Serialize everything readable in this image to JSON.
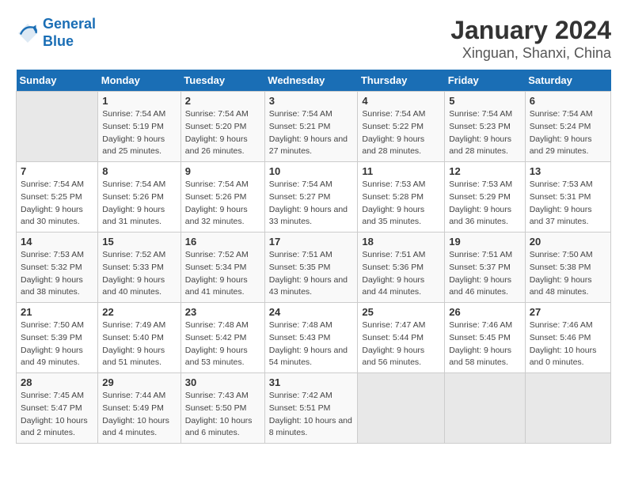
{
  "logo": {
    "line1": "General",
    "line2": "Blue"
  },
  "title": "January 2024",
  "subtitle": "Xinguan, Shanxi, China",
  "days_of_week": [
    "Sunday",
    "Monday",
    "Tuesday",
    "Wednesday",
    "Thursday",
    "Friday",
    "Saturday"
  ],
  "weeks": [
    [
      {
        "day": "",
        "sunrise": "",
        "sunset": "",
        "daylight": ""
      },
      {
        "day": "1",
        "sunrise": "Sunrise: 7:54 AM",
        "sunset": "Sunset: 5:19 PM",
        "daylight": "Daylight: 9 hours and 25 minutes."
      },
      {
        "day": "2",
        "sunrise": "Sunrise: 7:54 AM",
        "sunset": "Sunset: 5:20 PM",
        "daylight": "Daylight: 9 hours and 26 minutes."
      },
      {
        "day": "3",
        "sunrise": "Sunrise: 7:54 AM",
        "sunset": "Sunset: 5:21 PM",
        "daylight": "Daylight: 9 hours and 27 minutes."
      },
      {
        "day": "4",
        "sunrise": "Sunrise: 7:54 AM",
        "sunset": "Sunset: 5:22 PM",
        "daylight": "Daylight: 9 hours and 28 minutes."
      },
      {
        "day": "5",
        "sunrise": "Sunrise: 7:54 AM",
        "sunset": "Sunset: 5:23 PM",
        "daylight": "Daylight: 9 hours and 28 minutes."
      },
      {
        "day": "6",
        "sunrise": "Sunrise: 7:54 AM",
        "sunset": "Sunset: 5:24 PM",
        "daylight": "Daylight: 9 hours and 29 minutes."
      }
    ],
    [
      {
        "day": "7",
        "sunrise": "Sunrise: 7:54 AM",
        "sunset": "Sunset: 5:25 PM",
        "daylight": "Daylight: 9 hours and 30 minutes."
      },
      {
        "day": "8",
        "sunrise": "Sunrise: 7:54 AM",
        "sunset": "Sunset: 5:26 PM",
        "daylight": "Daylight: 9 hours and 31 minutes."
      },
      {
        "day": "9",
        "sunrise": "Sunrise: 7:54 AM",
        "sunset": "Sunset: 5:26 PM",
        "daylight": "Daylight: 9 hours and 32 minutes."
      },
      {
        "day": "10",
        "sunrise": "Sunrise: 7:54 AM",
        "sunset": "Sunset: 5:27 PM",
        "daylight": "Daylight: 9 hours and 33 minutes."
      },
      {
        "day": "11",
        "sunrise": "Sunrise: 7:53 AM",
        "sunset": "Sunset: 5:28 PM",
        "daylight": "Daylight: 9 hours and 35 minutes."
      },
      {
        "day": "12",
        "sunrise": "Sunrise: 7:53 AM",
        "sunset": "Sunset: 5:29 PM",
        "daylight": "Daylight: 9 hours and 36 minutes."
      },
      {
        "day": "13",
        "sunrise": "Sunrise: 7:53 AM",
        "sunset": "Sunset: 5:31 PM",
        "daylight": "Daylight: 9 hours and 37 minutes."
      }
    ],
    [
      {
        "day": "14",
        "sunrise": "Sunrise: 7:53 AM",
        "sunset": "Sunset: 5:32 PM",
        "daylight": "Daylight: 9 hours and 38 minutes."
      },
      {
        "day": "15",
        "sunrise": "Sunrise: 7:52 AM",
        "sunset": "Sunset: 5:33 PM",
        "daylight": "Daylight: 9 hours and 40 minutes."
      },
      {
        "day": "16",
        "sunrise": "Sunrise: 7:52 AM",
        "sunset": "Sunset: 5:34 PM",
        "daylight": "Daylight: 9 hours and 41 minutes."
      },
      {
        "day": "17",
        "sunrise": "Sunrise: 7:51 AM",
        "sunset": "Sunset: 5:35 PM",
        "daylight": "Daylight: 9 hours and 43 minutes."
      },
      {
        "day": "18",
        "sunrise": "Sunrise: 7:51 AM",
        "sunset": "Sunset: 5:36 PM",
        "daylight": "Daylight: 9 hours and 44 minutes."
      },
      {
        "day": "19",
        "sunrise": "Sunrise: 7:51 AM",
        "sunset": "Sunset: 5:37 PM",
        "daylight": "Daylight: 9 hours and 46 minutes."
      },
      {
        "day": "20",
        "sunrise": "Sunrise: 7:50 AM",
        "sunset": "Sunset: 5:38 PM",
        "daylight": "Daylight: 9 hours and 48 minutes."
      }
    ],
    [
      {
        "day": "21",
        "sunrise": "Sunrise: 7:50 AM",
        "sunset": "Sunset: 5:39 PM",
        "daylight": "Daylight: 9 hours and 49 minutes."
      },
      {
        "day": "22",
        "sunrise": "Sunrise: 7:49 AM",
        "sunset": "Sunset: 5:40 PM",
        "daylight": "Daylight: 9 hours and 51 minutes."
      },
      {
        "day": "23",
        "sunrise": "Sunrise: 7:48 AM",
        "sunset": "Sunset: 5:42 PM",
        "daylight": "Daylight: 9 hours and 53 minutes."
      },
      {
        "day": "24",
        "sunrise": "Sunrise: 7:48 AM",
        "sunset": "Sunset: 5:43 PM",
        "daylight": "Daylight: 9 hours and 54 minutes."
      },
      {
        "day": "25",
        "sunrise": "Sunrise: 7:47 AM",
        "sunset": "Sunset: 5:44 PM",
        "daylight": "Daylight: 9 hours and 56 minutes."
      },
      {
        "day": "26",
        "sunrise": "Sunrise: 7:46 AM",
        "sunset": "Sunset: 5:45 PM",
        "daylight": "Daylight: 9 hours and 58 minutes."
      },
      {
        "day": "27",
        "sunrise": "Sunrise: 7:46 AM",
        "sunset": "Sunset: 5:46 PM",
        "daylight": "Daylight: 10 hours and 0 minutes."
      }
    ],
    [
      {
        "day": "28",
        "sunrise": "Sunrise: 7:45 AM",
        "sunset": "Sunset: 5:47 PM",
        "daylight": "Daylight: 10 hours and 2 minutes."
      },
      {
        "day": "29",
        "sunrise": "Sunrise: 7:44 AM",
        "sunset": "Sunset: 5:49 PM",
        "daylight": "Daylight: 10 hours and 4 minutes."
      },
      {
        "day": "30",
        "sunrise": "Sunrise: 7:43 AM",
        "sunset": "Sunset: 5:50 PM",
        "daylight": "Daylight: 10 hours and 6 minutes."
      },
      {
        "day": "31",
        "sunrise": "Sunrise: 7:42 AM",
        "sunset": "Sunset: 5:51 PM",
        "daylight": "Daylight: 10 hours and 8 minutes."
      },
      {
        "day": "",
        "sunrise": "",
        "sunset": "",
        "daylight": ""
      },
      {
        "day": "",
        "sunrise": "",
        "sunset": "",
        "daylight": ""
      },
      {
        "day": "",
        "sunrise": "",
        "sunset": "",
        "daylight": ""
      }
    ]
  ]
}
